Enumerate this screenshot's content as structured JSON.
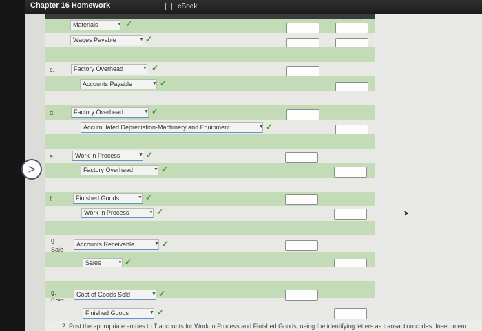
{
  "header": {
    "title": "Chapter 16 Homework",
    "ebook_label": "eBook"
  },
  "entries": [
    {
      "letter": "",
      "account": "Materials",
      "side": "debit"
    },
    {
      "letter": "",
      "account": "Wages Payable",
      "side": "credit"
    },
    {
      "letter": "c.",
      "account": "Factory Overhead",
      "side": "debit"
    },
    {
      "letter": "",
      "account": "Accounts Payable",
      "side": "credit"
    },
    {
      "letter": "d.",
      "account": "Factory Overhead",
      "side": "debit"
    },
    {
      "letter": "",
      "account": "Accumulated Depreciation-Machinery and Equipment",
      "side": "credit"
    },
    {
      "letter": "e.",
      "account": "Work in Process",
      "side": "debit"
    },
    {
      "letter": "",
      "account": "Factory Overhead",
      "side": "credit"
    },
    {
      "letter": "f.",
      "account": "Finished Goods",
      "side": "debit"
    },
    {
      "letter": "",
      "account": "Work in Process",
      "side": "credit"
    },
    {
      "letter": "g.",
      "letter2": "Sale",
      "account": "Accounts Receivable",
      "side": "debit"
    },
    {
      "letter": "",
      "account": "Sales",
      "side": "credit"
    },
    {
      "letter": "g.",
      "letter2": "Cost",
      "account": "Cost of Goods Sold",
      "side": "debit"
    },
    {
      "letter": "",
      "account": "Finished Goods",
      "side": "credit"
    }
  ],
  "icons": {
    "check": "✓",
    "caret": "▼",
    "nav": "chevron-right-icon"
  },
  "colors": {
    "green_row": "#c4dbb8",
    "check_green": "#3e9e2e"
  },
  "bottom_note": "2. Post the appropriate entries to T accounts for Work in Process and Finished Goods, using the identifying letters as transaction codes. Insert mem"
}
